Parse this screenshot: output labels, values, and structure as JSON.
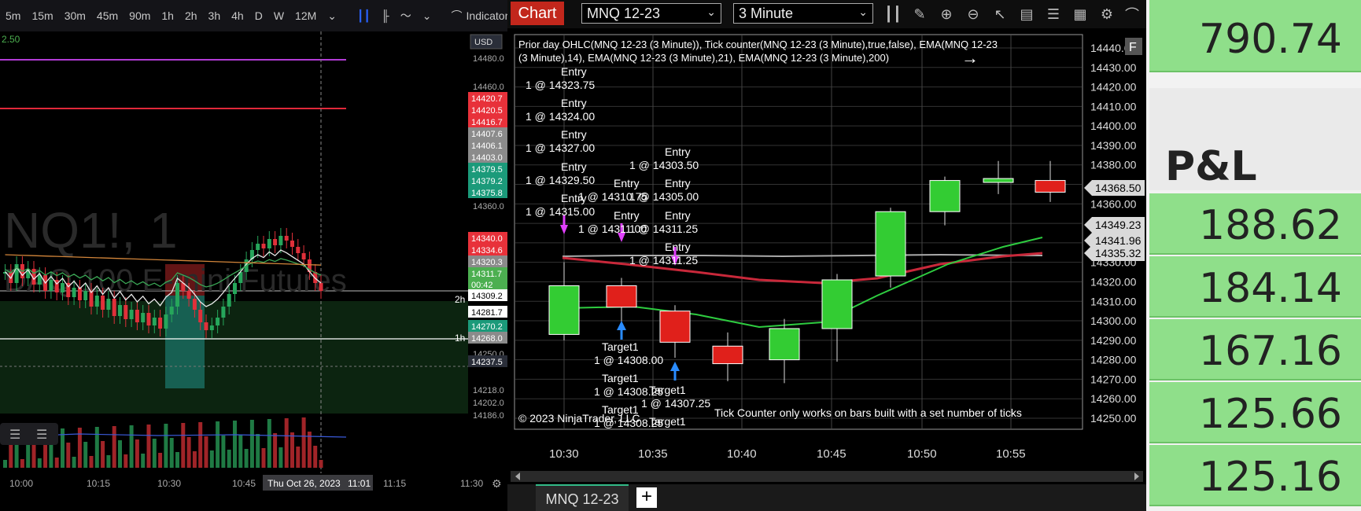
{
  "tradingview": {
    "toolbar": {
      "timeframes": [
        "5m",
        "15m",
        "30m",
        "45m",
        "90m",
        "1h",
        "2h",
        "3h",
        "4h",
        "D",
        "W",
        "12M"
      ],
      "indicators_label": "Indicators"
    },
    "currency_label": "USD",
    "top_left_value": "2.50",
    "watermark_symbol": "NQ1!, 1",
    "watermark_sub": "DAQ 100 E-mini Futures",
    "price_axis": [
      "14480.0",
      "14460.0",
      "14360.0",
      "14300.0",
      "14250.0",
      "14218.0",
      "14202.0",
      "14186.0"
    ],
    "price_badges": [
      {
        "text": "14420.7",
        "color": "#e8313a"
      },
      {
        "text": "14420.5",
        "color": "#e8313a"
      },
      {
        "text": "14416.7",
        "color": "#e8313a"
      },
      {
        "text": "14407.6",
        "color": "#8b8b8b"
      },
      {
        "text": "14406.1",
        "color": "#8b8b8b"
      },
      {
        "text": "14403.0",
        "color": "#8b8b8b"
      },
      {
        "text": "14379.5",
        "color": "#1b9a7a"
      },
      {
        "text": "14379.2",
        "color": "#1b9a7a"
      },
      {
        "text": "14375.8",
        "color": "#1b9a7a"
      },
      {
        "text": "14340.0",
        "color": "#e8313a"
      },
      {
        "text": "14334.6",
        "color": "#e8313a"
      },
      {
        "text": "14320.3",
        "color": "#8b8b8b"
      },
      {
        "text": "14311.7",
        "color": "#4caf50"
      },
      {
        "text": "00:42",
        "color": "#4caf50"
      },
      {
        "text": "14309.2",
        "color": "#ffffff"
      },
      {
        "text": "14281.7",
        "color": "#ffffff"
      },
      {
        "text": "14270.2",
        "color": "#1b9a7a"
      },
      {
        "text": "14268.0",
        "color": "#8b8b8b"
      },
      {
        "text": "14237.5",
        "color": "#2a2e39"
      }
    ],
    "line_labels": {
      "two_h": "2h",
      "one_h": "1h"
    },
    "time_axis": [
      "10:00",
      "10:15",
      "10:30",
      "10:45",
      "11:15",
      "11:30"
    ],
    "crosshair_time": "Thu Oct 26, 2023",
    "crosshair_time_value": "11:01"
  },
  "ninjatrader": {
    "chart_button": "Chart",
    "instrument": "MNQ 12-23",
    "interval": "3 Minute",
    "indicator_line1": "Prior day OHLC(MNQ 12-23 (3 Minute)), Tick counter(MNQ 12-23 (3 Minute),true,false), EMA(MNQ 12-23",
    "indicator_line2": "(3 Minute),14), EMA(MNQ 12-23 (3 Minute),21), EMA(MNQ 12-23 (3 Minute),200)",
    "price_axis": [
      "14440.00",
      "14430.00",
      "14420.00",
      "14410.00",
      "14400.00",
      "14390.00",
      "14380.00",
      "14370.00",
      "14360.00",
      "14350.00",
      "14340.00",
      "14330.00",
      "14320.00",
      "14310.00",
      "14300.00",
      "14290.00",
      "14280.00",
      "14270.00",
      "14260.00",
      "14250.00"
    ],
    "price_markers": [
      {
        "text": "14368.50",
        "color": "#d9d9d9"
      },
      {
        "text": "14349.23",
        "color": "#d9d9d9"
      },
      {
        "text": "14341.96",
        "color": "#d9d9d9"
      },
      {
        "text": "14335.32",
        "color": "#d9d9d9"
      }
    ],
    "time_axis": [
      "10:30",
      "10:35",
      "10:40",
      "10:45",
      "10:50",
      "10:55"
    ],
    "entries": [
      {
        "label": "Entry",
        "price": "1 @ 14323.75"
      },
      {
        "label": "Entry",
        "price": "1 @ 14324.00"
      },
      {
        "label": "Entry",
        "price": "1 @ 14327.00"
      },
      {
        "label": "Entry",
        "price": "1 @ 14329.50"
      },
      {
        "label": "Entry",
        "price": "1 @ 14315.00"
      },
      {
        "label": "Entry",
        "price": "1 @ 14310.75"
      },
      {
        "label": "Entry",
        "price": "1 @ 14311.00"
      },
      {
        "label": "Entry",
        "price": "1 @ 14303.50"
      },
      {
        "label": "Entry",
        "price": "1 @ 14305.00"
      },
      {
        "label": "Entry",
        "price": "1 @ 14311.25"
      },
      {
        "label": "Entry",
        "price": "1 @ 14311.25"
      }
    ],
    "targets": [
      {
        "label": "Target1",
        "price": "1 @ 14308.00"
      },
      {
        "label": "Target1",
        "price": "1 @ 14308.25"
      },
      {
        "label": "Target1",
        "price": "1 @ 14308.25"
      },
      {
        "label": "Target1",
        "price": "1 @ 14307.25"
      },
      {
        "label": "Target1",
        "price": ""
      }
    ],
    "copyright": "© 2023 NinjaTrader, LLC",
    "tick_note": "Tick Counter only works on bars built with a set number of ticks",
    "tab_label": "MNQ 12-23",
    "plus_label": "+",
    "corner_label": "F"
  },
  "pnl": {
    "top_value": "790.74",
    "header": "P&L",
    "values": [
      "188.62",
      "184.14",
      "167.16",
      "125.66",
      "125.16"
    ]
  },
  "colors": {
    "up": "#2ecc40",
    "down": "#e0201b",
    "pnl_green": "#8fdf8a",
    "nt_red": "#c2271c"
  }
}
